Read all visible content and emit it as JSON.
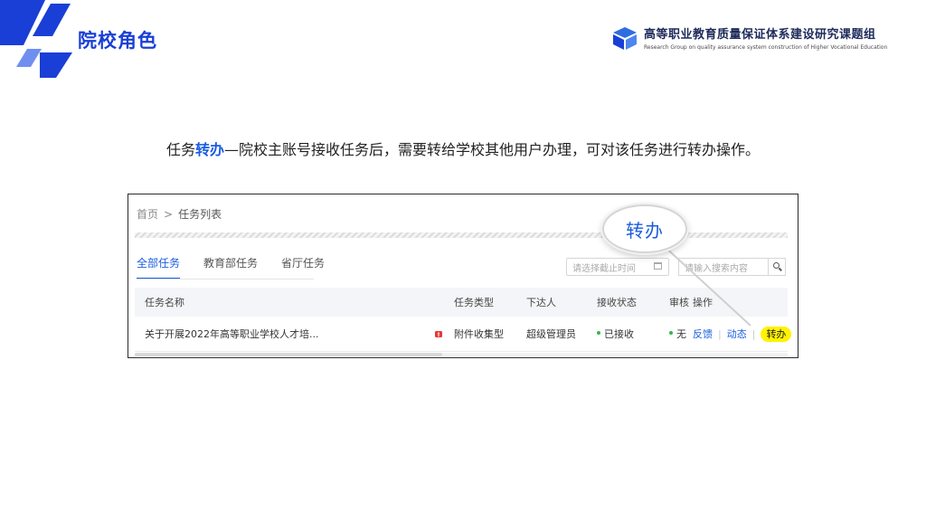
{
  "slide": {
    "title": "院校角色",
    "org_name_cn": "高等职业教育质量保证体系建设研究课题组",
    "org_name_en": "Research Group on quality assurance system construction of Higher Vocational Education",
    "accent_color": "#1a3fd6"
  },
  "caption": {
    "prefix": "任务",
    "highlight": "转办",
    "text": "—院校主账号接收任务后，需要转给学校其他用户办理，可对该任务进行转办操作。"
  },
  "app": {
    "breadcrumb": {
      "home": "首页",
      "current": "任务列表"
    },
    "tabs": [
      {
        "label": "全部任务",
        "active": true
      },
      {
        "label": "教育部任务",
        "active": false
      },
      {
        "label": "省厅任务",
        "active": false
      }
    ],
    "date_placeholder": "请选择截止时间",
    "search_placeholder": "请输入搜索内容",
    "table": {
      "columns": [
        "任务名称",
        "任务类型",
        "下达人",
        "接收状态",
        "审核",
        "操作"
      ],
      "rows": [
        {
          "name": "关于开展2022年高等职业学校人才培...",
          "type": "附件收集型",
          "issuer": "超级管理员",
          "receive_status": "已接收",
          "review_status": "无",
          "actions": [
            "反馈",
            "动态",
            "转办"
          ]
        }
      ]
    },
    "magnifier_label": "转办",
    "status_color": "#33b94a",
    "link_color": "#1a5ce0"
  }
}
